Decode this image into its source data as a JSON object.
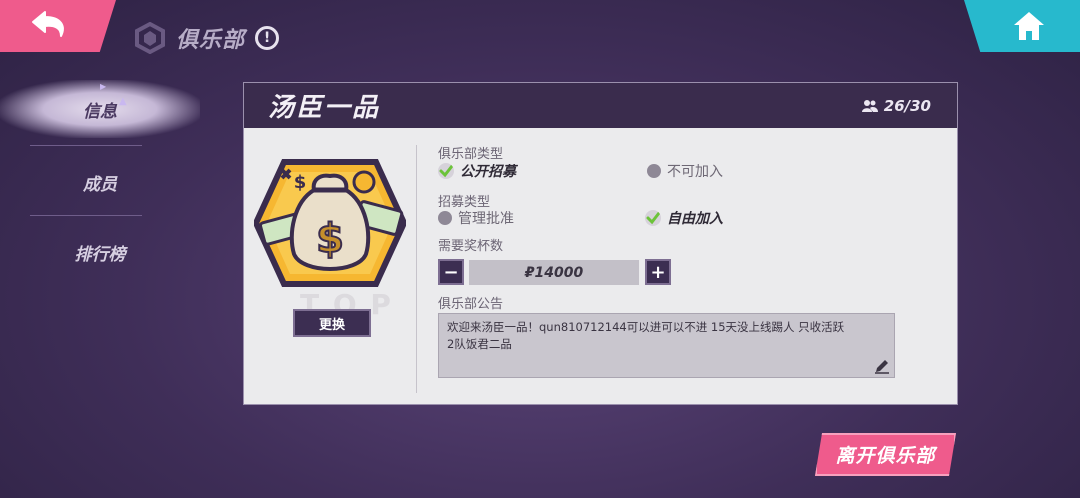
{
  "header": {
    "title": "俱乐部",
    "info_icon_text": "!",
    "icons": {
      "back": "back-arrow-icon",
      "home": "home-icon",
      "club_logo": "club-logo-icon",
      "info": "info-icon"
    }
  },
  "colors": {
    "accent_pink": "#ef5b8c",
    "accent_cyan": "#27b9cd",
    "panel_header": "#3a2c4d",
    "background": "#3f2e58"
  },
  "sidebar": {
    "items": [
      {
        "label": "信息",
        "active": true
      },
      {
        "label": "成员",
        "active": false
      },
      {
        "label": "排行榜",
        "active": false
      }
    ]
  },
  "club": {
    "name": "汤臣一品",
    "member_count": "26/30",
    "emblem_icon": "money-bag-emblem-icon",
    "emblem_watermark": "T  O  P",
    "change_label": "更换"
  },
  "club_type": {
    "label": "俱乐部类型",
    "options": [
      {
        "label": "公开招募",
        "selected": true
      },
      {
        "label": "不可加入",
        "selected": false
      }
    ]
  },
  "recruit_type": {
    "label": "招募类型",
    "options": [
      {
        "label": "管理批准",
        "selected": false
      },
      {
        "label": "自由加入",
        "selected": true
      }
    ]
  },
  "trophy": {
    "label": "需要奖杯数",
    "value": "₽14000",
    "minus": "−",
    "plus": "+"
  },
  "notice": {
    "label": "俱乐部公告",
    "lines": [
      "欢迎来汤臣一品！qun810712144可以进可以不进 15天没上线踢人 只收活跃",
      "2队饭君二品"
    ]
  },
  "leave_label": "离开俱乐部"
}
